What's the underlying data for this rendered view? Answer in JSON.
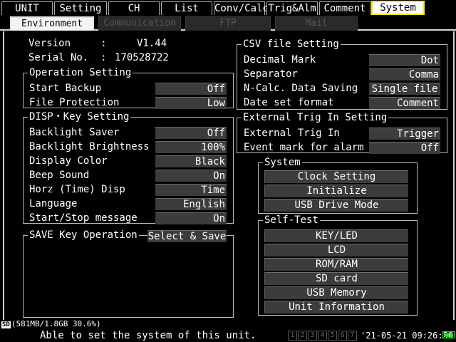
{
  "top_tabs": [
    "UNIT",
    "Setting",
    "CH",
    "List",
    "Conv/Calc",
    "Trig&Alm",
    "Comment",
    "System"
  ],
  "sub_tabs": [
    "Environment",
    "Communication",
    "FTP",
    "Mail"
  ],
  "info": {
    "version_label": "Version     :",
    "version_value": "V1.44",
    "serial_label": "Serial No.  :",
    "serial_value": "170528722"
  },
  "operation": {
    "title": "Operation Setting",
    "start_backup_label": "Start Backup",
    "start_backup_value": "Off",
    "file_protection_label": "File Protection",
    "file_protection_value": "Low"
  },
  "disp": {
    "title": "DISP・Key Setting",
    "rows": [
      {
        "label": "Backlight Saver",
        "value": "Off"
      },
      {
        "label": "Backlight Brightness",
        "value": "100%"
      },
      {
        "label": "Display Color",
        "value": "Black"
      },
      {
        "label": "Beep Sound",
        "value": "On"
      },
      {
        "label": "Horz (Time) Disp",
        "value": "Time"
      },
      {
        "label": "Language",
        "value": "English"
      },
      {
        "label": "Start/Stop message",
        "value": "On"
      }
    ]
  },
  "save_key": {
    "title": "SAVE Key Operation",
    "value": "Select & Save"
  },
  "csv": {
    "title": "CSV file Setting",
    "rows": [
      {
        "label": "Decimal Mark",
        "value": "Dot"
      },
      {
        "label": "Separator",
        "value": "Comma"
      },
      {
        "label": "N-Calc. Data Saving",
        "value": "Single file"
      },
      {
        "label": "Date set format",
        "value": "Comment"
      }
    ]
  },
  "ext_trig": {
    "title": "External Trig In Setting",
    "rows": [
      {
        "label": "External Trig In",
        "value": "Trigger"
      },
      {
        "label": "Event mark for alarm",
        "value": "Off"
      }
    ]
  },
  "system": {
    "title": "System",
    "buttons": [
      "Clock Setting",
      "Initialize",
      "USB Drive Mode"
    ]
  },
  "self_test": {
    "title": "Self-Test",
    "buttons": [
      "KEY/LED",
      "LCD",
      "ROM/RAM",
      "SD card",
      "USB Memory",
      "Unit Information"
    ]
  },
  "status": {
    "sd_icon": "SD",
    "storage": "(581MB/1.8GB 30.6%)",
    "message": "Able to set the system of this unit.",
    "channels": [
      "1",
      "2",
      "3",
      "4",
      "5",
      "6",
      "7"
    ],
    "datetime": "'21-05-21 09:26:50"
  },
  "colors": {
    "active_tab_border": "#ffe800",
    "value_bg": "#3c3c3c",
    "battery": "#00ff00"
  }
}
